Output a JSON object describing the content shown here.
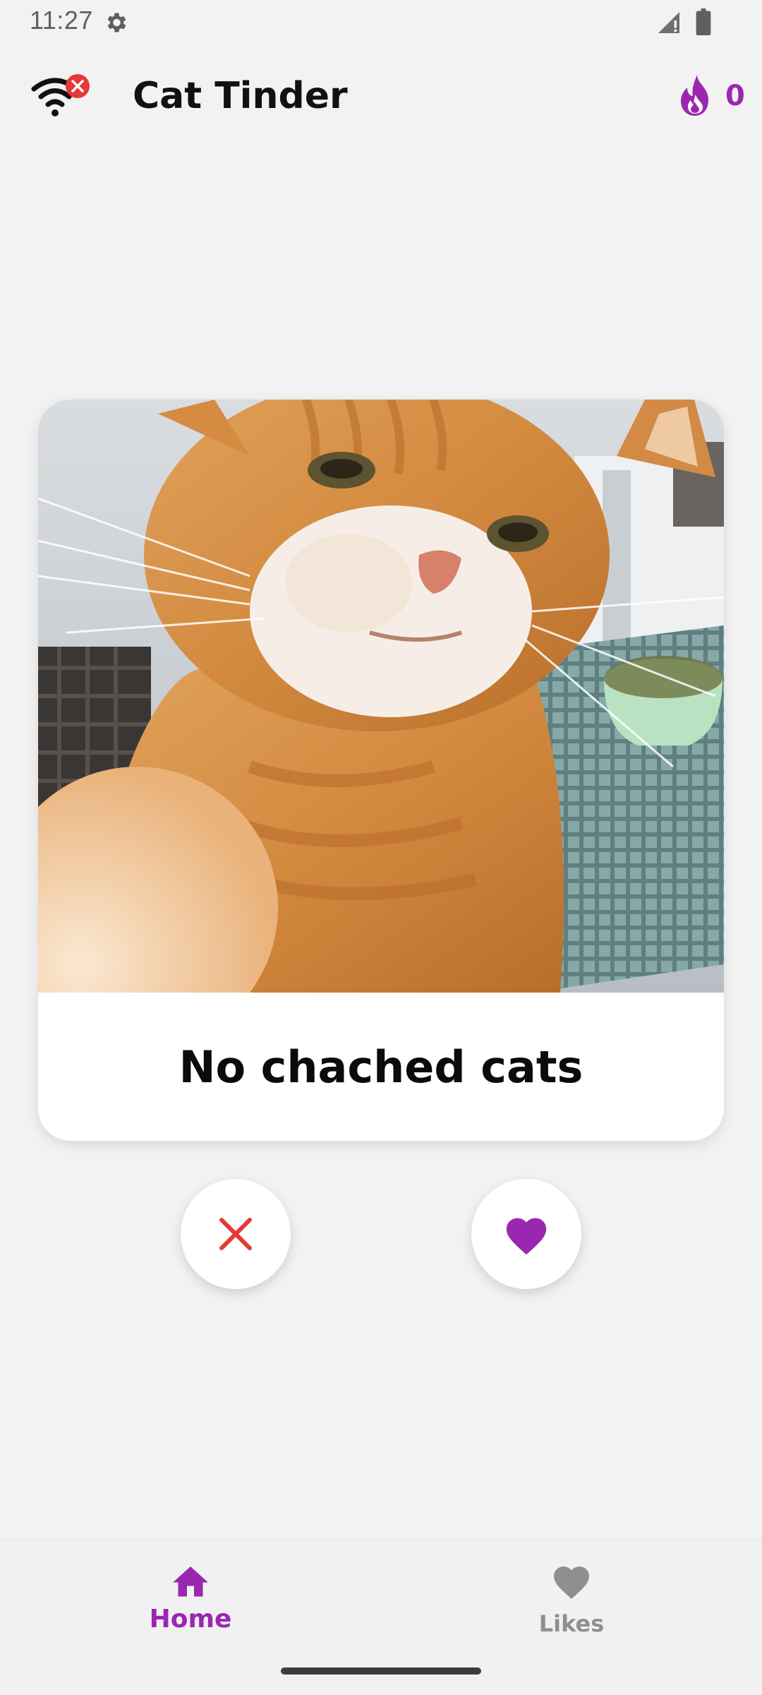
{
  "status_bar": {
    "time": "11:27"
  },
  "app_bar": {
    "title": "Cat Tinder",
    "like_count": "0"
  },
  "card": {
    "caption": "No chached cats"
  },
  "bottom_nav": {
    "items": [
      {
        "label": "Home",
        "icon": "home-icon",
        "active": true
      },
      {
        "label": "Likes",
        "icon": "heart-icon",
        "active": false
      }
    ]
  },
  "colors": {
    "accent": "#9b27b0",
    "dislike": "#e53935",
    "background": "#f2f2f2",
    "offline_badge": "#e53935"
  }
}
